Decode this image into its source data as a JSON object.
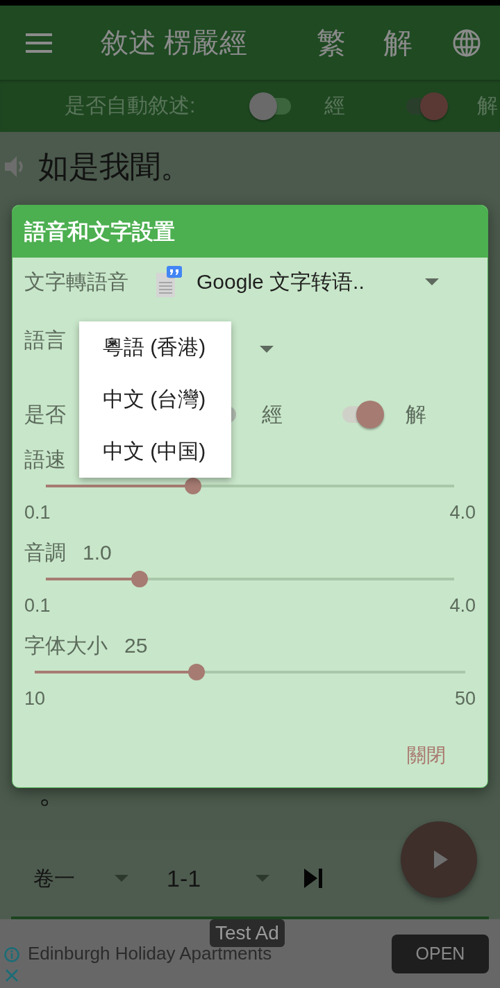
{
  "app_bar": {
    "title": "敘述 楞嚴經",
    "actions": [
      {
        "label": "繁"
      },
      {
        "label": "解"
      }
    ]
  },
  "auto_narrate_bar": {
    "label": "是否自動敘述:",
    "toggles": [
      {
        "label": "經",
        "on": false
      },
      {
        "label": "解",
        "on": true
      }
    ]
  },
  "scripture": {
    "lines": [
      {
        "text": "如是我聞。",
        "speaking": true
      },
      {
        "text": "。",
        "speaking": false
      }
    ]
  },
  "dialog": {
    "title": "語音和文字設置",
    "engine": {
      "label": "文字轉語音",
      "value": "Google 文字转语.."
    },
    "language": {
      "label": "語言",
      "menu": [
        {
          "label": "粵語 (香港)",
          "selected": false
        },
        {
          "label": "中文 (台灣)",
          "selected": false
        },
        {
          "label": "中文 (中国)",
          "selected": false
        }
      ]
    },
    "auto_narrate": {
      "label": "是否",
      "toggles": [
        {
          "label": "經",
          "on": false
        },
        {
          "label": "解",
          "on": true
        }
      ]
    },
    "sliders": [
      {
        "label": "語速",
        "level": 0.36,
        "min": "0.1",
        "max": "4.0"
      },
      {
        "label": "音調",
        "value": "1.0",
        "level": 0.23,
        "min": "0.1",
        "max": "4.0"
      },
      {
        "label": "字体大小",
        "value": "25",
        "level": 0.376,
        "min": "10",
        "max": "50"
      }
    ],
    "close_button": "關閉"
  },
  "bottom_bar": {
    "volume": "卷一",
    "section": "1-1"
  },
  "ad": {
    "badge": "Test Ad",
    "title": "Edinburgh Holiday Apartments",
    "button": "OPEN"
  }
}
